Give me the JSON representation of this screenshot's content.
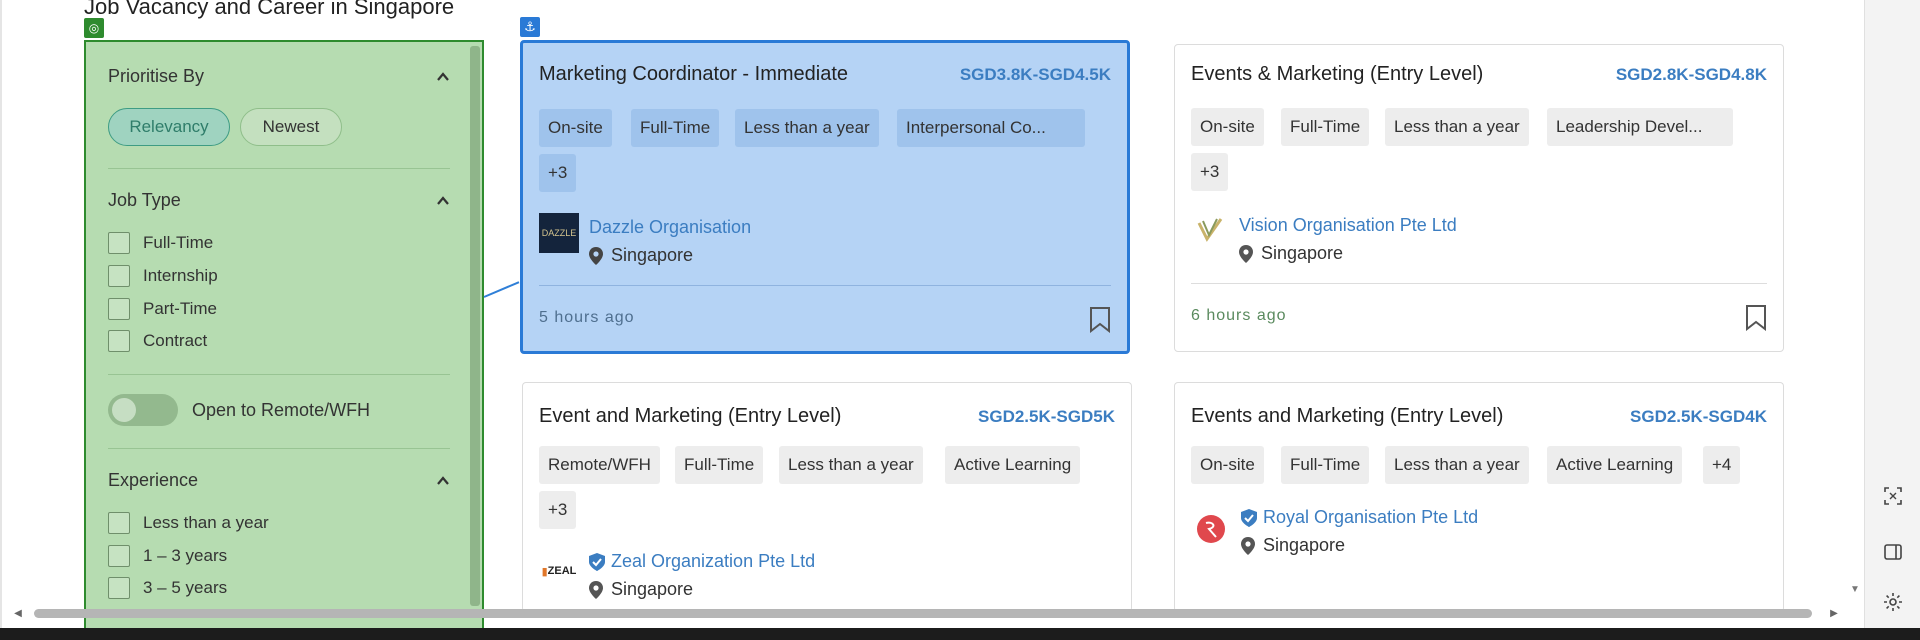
{
  "page": {
    "title": "Job Vacancy and Career in Singapore"
  },
  "sidebar": {
    "prioritise": {
      "heading": "Prioritise By",
      "options": [
        "Relevancy",
        "Newest"
      ],
      "selected": "Relevancy"
    },
    "job_type": {
      "heading": "Job Type",
      "options": [
        "Full-Time",
        "Internship",
        "Part-Time",
        "Contract"
      ]
    },
    "remote_toggle": {
      "label": "Open to Remote/WFH",
      "on": false
    },
    "experience": {
      "heading": "Experience",
      "options": [
        "Less than a year",
        "1 – 3 years",
        "3 – 5 years"
      ]
    }
  },
  "jobs": [
    {
      "title": "Marketing Coordinator - Immediate",
      "salary": "SGD3.8K-SGD4.5K",
      "tags": [
        "On-site",
        "Full-Time",
        "Less than a year",
        "Interpersonal Co..."
      ],
      "more": "+3",
      "company": "Dazzle Organisation",
      "location": "Singapore",
      "posted": "5 hours ago",
      "logo_text": "DAZZLE"
    },
    {
      "title": "Events & Marketing (Entry Level)",
      "salary": "SGD2.8K-SGD4.8K",
      "tags": [
        "On-site",
        "Full-Time",
        "Less than a year",
        "Leadership Devel..."
      ],
      "more": "+3",
      "company": "Vision Organisation Pte Ltd",
      "location": "Singapore",
      "posted": "6 hours ago"
    },
    {
      "title": "Event and Marketing (Entry Level)",
      "salary": "SGD2.5K-SGD5K",
      "tags": [
        "Remote/WFH",
        "Full-Time",
        "Less than a year",
        "Active Learning"
      ],
      "more": "+3",
      "company": "Zeal Organization Pte Ltd",
      "location": "Singapore",
      "logo_text": "ZEAL"
    },
    {
      "title": "Events and Marketing (Entry Level)",
      "salary": "SGD2.5K-SGD4K",
      "tags": [
        "On-site",
        "Full-Time",
        "Less than a year",
        "Active Learning"
      ],
      "more": "+4",
      "company": "Royal Organisation Pte Ltd",
      "location": "Singapore"
    }
  ],
  "colors": {
    "accent": "#3b7dc1",
    "selected_card": "#b5d3f5",
    "filter_panel": "#b6dcb1"
  },
  "icons": [
    "anchor-icon",
    "target-icon",
    "chevron-up-icon",
    "location-pin-icon",
    "bookmark-icon",
    "verified-shield-icon",
    "screenshot-icon",
    "sidebar-icon",
    "gear-icon"
  ]
}
